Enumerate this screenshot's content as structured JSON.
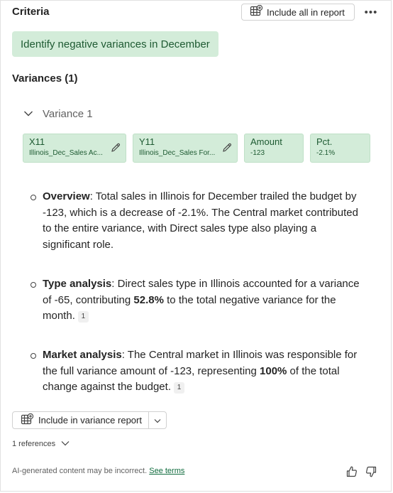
{
  "header": {
    "title": "Criteria",
    "include_all_label": "Include all in report",
    "more_icon": "more-horizontal-icon"
  },
  "criteria": {
    "text": "Identify negative variances in December"
  },
  "variances_section": {
    "heading": "Variances (1)",
    "variance": {
      "label": "Variance 1",
      "expanded": true,
      "cards": [
        {
          "key": "X11",
          "value": "Illinois_Dec_Sales Ac...",
          "editable": true
        },
        {
          "key": "Y11",
          "value": "Illinois_Dec_Sales For...",
          "editable": true
        },
        {
          "key": "Amount",
          "value": "-123",
          "editable": false
        },
        {
          "key": "Pct.",
          "value": "-2.1%",
          "editable": false
        }
      ]
    }
  },
  "analysis": [
    {
      "heading": "Overview",
      "text_1": ": Total sales in Illinois for December trailed the budget by -123, which is a decrease of -2.1%. The Central market contributed to the entire variance, with Direct sales type also playing a significant role.",
      "bold": "",
      "text_2": "",
      "citation": ""
    },
    {
      "heading": "Type analysis",
      "text_1": ": Direct sales type in Illinois accounted for a variance of -65, contributing ",
      "bold": "52.8%",
      "text_2": " to the total negative variance for the month.",
      "citation": "1"
    },
    {
      "heading": "Market analysis",
      "text_1": ": The Central market in Illinois was responsible for the full variance amount of -123, representing ",
      "bold": "100%",
      "text_2": " of the total change against the budget.",
      "citation": "1"
    }
  ],
  "actions": {
    "include_variance_label": "Include in variance report"
  },
  "references": {
    "label": "1 references"
  },
  "footer": {
    "disclaimer": "AI-generated content may be incorrect.",
    "link": "See terms"
  },
  "colors": {
    "chip_bg": "#d3ecd9",
    "chip_text": "#1e5a32",
    "link": "#0f6b3d"
  }
}
